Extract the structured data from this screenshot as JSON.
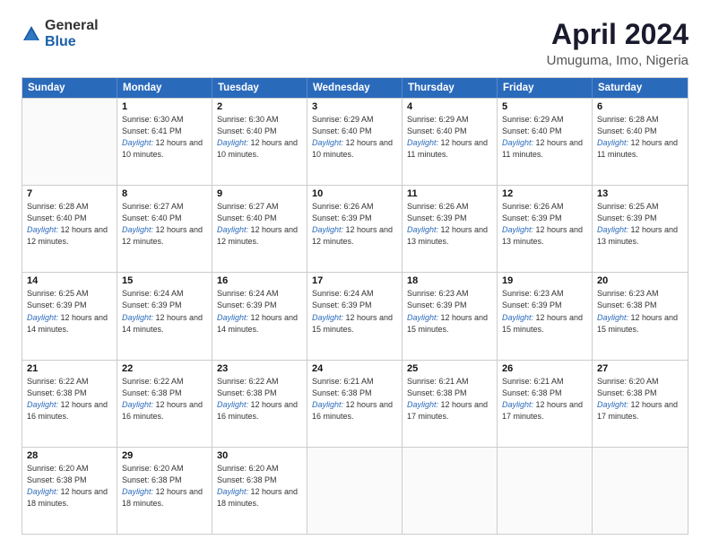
{
  "logo": {
    "general": "General",
    "blue": "Blue"
  },
  "title": {
    "month": "April 2024",
    "location": "Umuguma, Imo, Nigeria"
  },
  "calendar": {
    "headers": [
      "Sunday",
      "Monday",
      "Tuesday",
      "Wednesday",
      "Thursday",
      "Friday",
      "Saturday"
    ],
    "weeks": [
      [
        {
          "day": "",
          "sunrise": "",
          "sunset": "",
          "daylight": "",
          "empty": true
        },
        {
          "day": "1",
          "sunrise": "Sunrise: 6:30 AM",
          "sunset": "Sunset: 6:41 PM",
          "daylight": "Daylight: 12 hours and 10 minutes."
        },
        {
          "day": "2",
          "sunrise": "Sunrise: 6:30 AM",
          "sunset": "Sunset: 6:40 PM",
          "daylight": "Daylight: 12 hours and 10 minutes."
        },
        {
          "day": "3",
          "sunrise": "Sunrise: 6:29 AM",
          "sunset": "Sunset: 6:40 PM",
          "daylight": "Daylight: 12 hours and 10 minutes."
        },
        {
          "day": "4",
          "sunrise": "Sunrise: 6:29 AM",
          "sunset": "Sunset: 6:40 PM",
          "daylight": "Daylight: 12 hours and 11 minutes."
        },
        {
          "day": "5",
          "sunrise": "Sunrise: 6:29 AM",
          "sunset": "Sunset: 6:40 PM",
          "daylight": "Daylight: 12 hours and 11 minutes."
        },
        {
          "day": "6",
          "sunrise": "Sunrise: 6:28 AM",
          "sunset": "Sunset: 6:40 PM",
          "daylight": "Daylight: 12 hours and 11 minutes."
        }
      ],
      [
        {
          "day": "7",
          "sunrise": "Sunrise: 6:28 AM",
          "sunset": "Sunset: 6:40 PM",
          "daylight": "Daylight: 12 hours and 12 minutes."
        },
        {
          "day": "8",
          "sunrise": "Sunrise: 6:27 AM",
          "sunset": "Sunset: 6:40 PM",
          "daylight": "Daylight: 12 hours and 12 minutes."
        },
        {
          "day": "9",
          "sunrise": "Sunrise: 6:27 AM",
          "sunset": "Sunset: 6:40 PM",
          "daylight": "Daylight: 12 hours and 12 minutes."
        },
        {
          "day": "10",
          "sunrise": "Sunrise: 6:26 AM",
          "sunset": "Sunset: 6:39 PM",
          "daylight": "Daylight: 12 hours and 12 minutes."
        },
        {
          "day": "11",
          "sunrise": "Sunrise: 6:26 AM",
          "sunset": "Sunset: 6:39 PM",
          "daylight": "Daylight: 12 hours and 13 minutes."
        },
        {
          "day": "12",
          "sunrise": "Sunrise: 6:26 AM",
          "sunset": "Sunset: 6:39 PM",
          "daylight": "Daylight: 12 hours and 13 minutes."
        },
        {
          "day": "13",
          "sunrise": "Sunrise: 6:25 AM",
          "sunset": "Sunset: 6:39 PM",
          "daylight": "Daylight: 12 hours and 13 minutes."
        }
      ],
      [
        {
          "day": "14",
          "sunrise": "Sunrise: 6:25 AM",
          "sunset": "Sunset: 6:39 PM",
          "daylight": "Daylight: 12 hours and 14 minutes."
        },
        {
          "day": "15",
          "sunrise": "Sunrise: 6:24 AM",
          "sunset": "Sunset: 6:39 PM",
          "daylight": "Daylight: 12 hours and 14 minutes."
        },
        {
          "day": "16",
          "sunrise": "Sunrise: 6:24 AM",
          "sunset": "Sunset: 6:39 PM",
          "daylight": "Daylight: 12 hours and 14 minutes."
        },
        {
          "day": "17",
          "sunrise": "Sunrise: 6:24 AM",
          "sunset": "Sunset: 6:39 PM",
          "daylight": "Daylight: 12 hours and 15 minutes."
        },
        {
          "day": "18",
          "sunrise": "Sunrise: 6:23 AM",
          "sunset": "Sunset: 6:39 PM",
          "daylight": "Daylight: 12 hours and 15 minutes."
        },
        {
          "day": "19",
          "sunrise": "Sunrise: 6:23 AM",
          "sunset": "Sunset: 6:39 PM",
          "daylight": "Daylight: 12 hours and 15 minutes."
        },
        {
          "day": "20",
          "sunrise": "Sunrise: 6:23 AM",
          "sunset": "Sunset: 6:38 PM",
          "daylight": "Daylight: 12 hours and 15 minutes."
        }
      ],
      [
        {
          "day": "21",
          "sunrise": "Sunrise: 6:22 AM",
          "sunset": "Sunset: 6:38 PM",
          "daylight": "Daylight: 12 hours and 16 minutes."
        },
        {
          "day": "22",
          "sunrise": "Sunrise: 6:22 AM",
          "sunset": "Sunset: 6:38 PM",
          "daylight": "Daylight: 12 hours and 16 minutes."
        },
        {
          "day": "23",
          "sunrise": "Sunrise: 6:22 AM",
          "sunset": "Sunset: 6:38 PM",
          "daylight": "Daylight: 12 hours and 16 minutes."
        },
        {
          "day": "24",
          "sunrise": "Sunrise: 6:21 AM",
          "sunset": "Sunset: 6:38 PM",
          "daylight": "Daylight: 12 hours and 16 minutes."
        },
        {
          "day": "25",
          "sunrise": "Sunrise: 6:21 AM",
          "sunset": "Sunset: 6:38 PM",
          "daylight": "Daylight: 12 hours and 17 minutes."
        },
        {
          "day": "26",
          "sunrise": "Sunrise: 6:21 AM",
          "sunset": "Sunset: 6:38 PM",
          "daylight": "Daylight: 12 hours and 17 minutes."
        },
        {
          "day": "27",
          "sunrise": "Sunrise: 6:20 AM",
          "sunset": "Sunset: 6:38 PM",
          "daylight": "Daylight: 12 hours and 17 minutes."
        }
      ],
      [
        {
          "day": "28",
          "sunrise": "Sunrise: 6:20 AM",
          "sunset": "Sunset: 6:38 PM",
          "daylight": "Daylight: 12 hours and 18 minutes."
        },
        {
          "day": "29",
          "sunrise": "Sunrise: 6:20 AM",
          "sunset": "Sunset: 6:38 PM",
          "daylight": "Daylight: 12 hours and 18 minutes."
        },
        {
          "day": "30",
          "sunrise": "Sunrise: 6:20 AM",
          "sunset": "Sunset: 6:38 PM",
          "daylight": "Daylight: 12 hours and 18 minutes."
        },
        {
          "day": "",
          "sunrise": "",
          "sunset": "",
          "daylight": "",
          "empty": true
        },
        {
          "day": "",
          "sunrise": "",
          "sunset": "",
          "daylight": "",
          "empty": true
        },
        {
          "day": "",
          "sunrise": "",
          "sunset": "",
          "daylight": "",
          "empty": true
        },
        {
          "day": "",
          "sunrise": "",
          "sunset": "",
          "daylight": "",
          "empty": true
        }
      ]
    ]
  }
}
